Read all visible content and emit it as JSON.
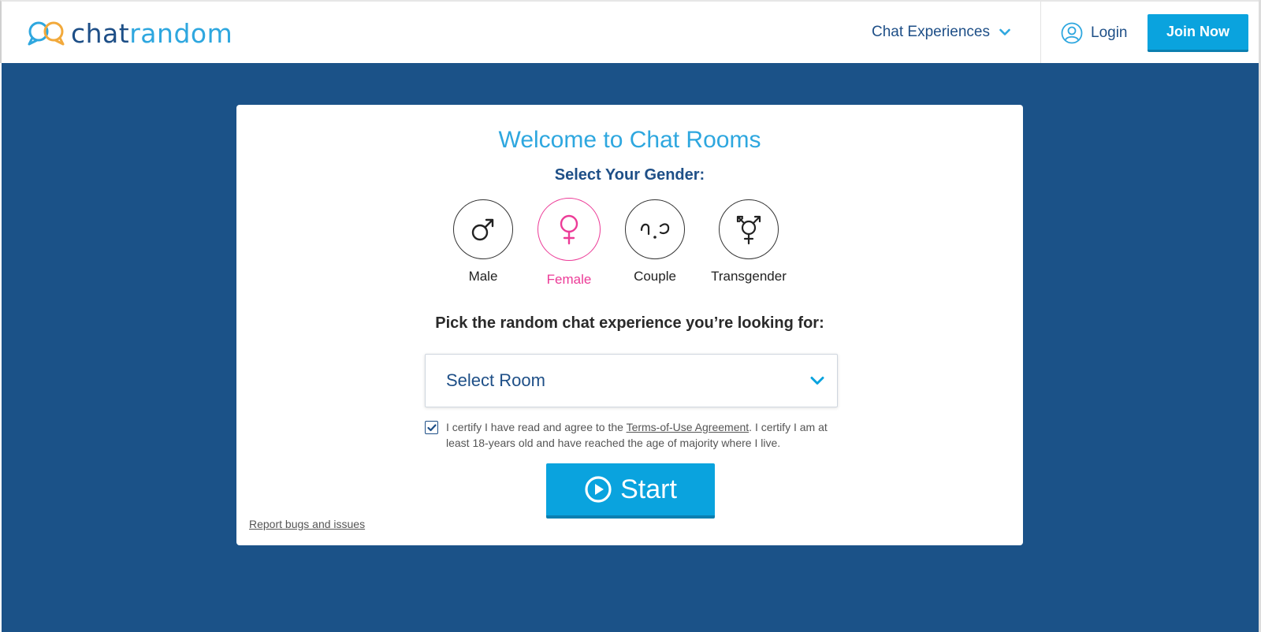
{
  "header": {
    "logo_chat": "chat",
    "logo_random": "random",
    "nav_experiences": "Chat Experiences",
    "login": "Login",
    "join": "Join Now"
  },
  "card": {
    "title": "Welcome to Chat Rooms",
    "gender_prompt": "Select Your Gender:",
    "genders": [
      {
        "label": "Male",
        "icon": "male-symbol-icon",
        "selected": false
      },
      {
        "label": "Female",
        "icon": "female-symbol-icon",
        "selected": true
      },
      {
        "label": "Couple",
        "icon": "couple-icon",
        "selected": false
      },
      {
        "label": "Transgender",
        "icon": "transgender-symbol-icon",
        "selected": false
      }
    ],
    "pick_prompt": "Pick the random chat experience you’re looking for:",
    "room_select_value": "Select Room",
    "certify_before": "I certify I have read and agree to the ",
    "certify_link": "Terms-of-Use Agreement",
    "certify_after": ". I certify I am at least 18-years old and have reached the age of majority where I live.",
    "certify_checked": true,
    "start": "Start",
    "report": "Report bugs and issues"
  },
  "colors": {
    "brand_dark": "#1e4f87",
    "brand_light": "#2ea7df",
    "background": "#1b5288",
    "button": "#0aa3de",
    "accent_pink": "#ec3b97"
  }
}
